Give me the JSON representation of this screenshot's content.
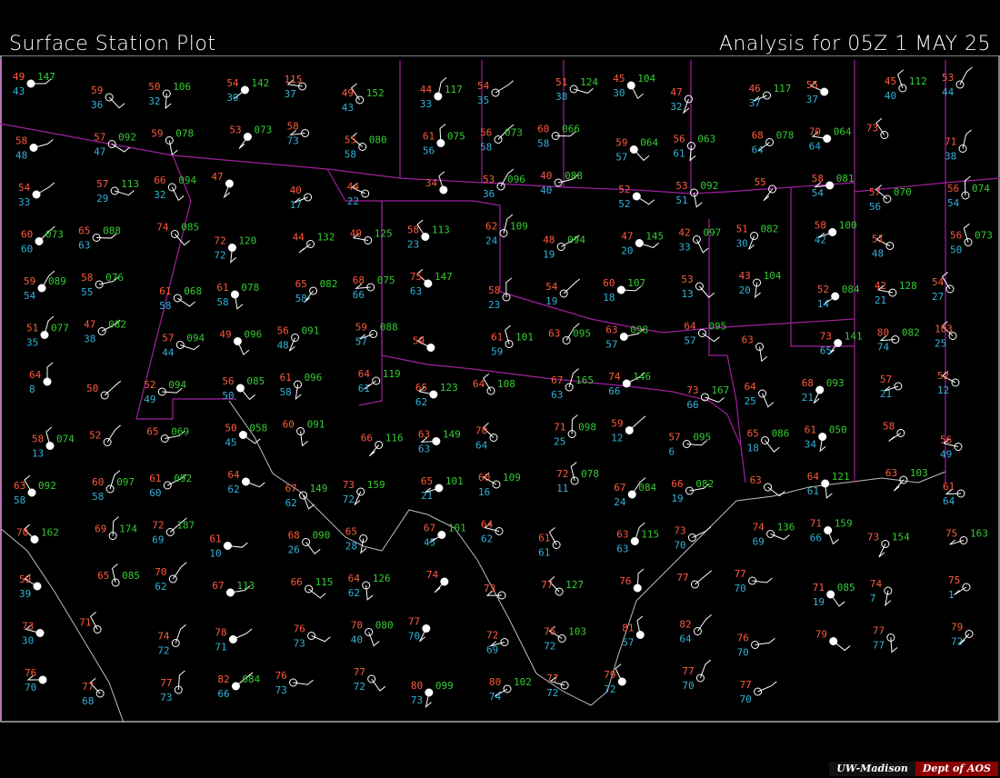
{
  "header": {
    "title": "Surface Station Plot",
    "analysis": "Analysis for 05Z  1 MAY 25"
  },
  "credit": {
    "university": "UW-Madison",
    "dept": "Dept of AOS"
  },
  "colors": {
    "temperature": "#ff5a3c",
    "dewpoint": "#31b2d9",
    "pressure": "#33cc33",
    "station": "#ffffff",
    "borders": "#a020a0",
    "coast": "#cfcfcf"
  },
  "stations": [
    {
      "t": "49",
      "d": "43",
      "p": "147"
    },
    {
      "t": "59",
      "d": "36",
      "p": ""
    },
    {
      "t": "50",
      "d": "32",
      "p": "106"
    },
    {
      "t": "54",
      "d": "39",
      "p": "142"
    },
    {
      "t": "115",
      "d": "37",
      "p": ""
    },
    {
      "t": "49",
      "d": "43",
      "p": "152"
    },
    {
      "t": "44",
      "d": "33",
      "p": "117"
    },
    {
      "t": "54",
      "d": "35",
      "p": ""
    },
    {
      "t": "51",
      "d": "38",
      "p": "124"
    },
    {
      "t": "45",
      "d": "30",
      "p": "104"
    },
    {
      "t": "47",
      "d": "32",
      "p": ""
    },
    {
      "t": "46",
      "d": "37",
      "p": "117"
    },
    {
      "t": "55",
      "d": "37",
      "p": ""
    },
    {
      "t": "45",
      "d": "40",
      "p": "112"
    },
    {
      "t": "53",
      "d": "44",
      "p": ""
    },
    {
      "t": "58",
      "d": "48",
      "p": ""
    },
    {
      "t": "57",
      "d": "47",
      "p": "092"
    },
    {
      "t": "59",
      "d": "",
      "p": "078"
    },
    {
      "t": "53",
      "d": "",
      "p": "073"
    },
    {
      "t": "58",
      "d": "73",
      "p": ""
    },
    {
      "t": "55",
      "d": "58",
      "p": "080"
    },
    {
      "t": "61",
      "d": "56",
      "p": "075"
    },
    {
      "t": "56",
      "d": "58",
      "p": "073"
    },
    {
      "t": "60",
      "d": "58",
      "p": "066"
    },
    {
      "t": "59",
      "d": "57",
      "p": "064"
    },
    {
      "t": "56",
      "d": "61",
      "p": "063"
    },
    {
      "t": "68",
      "d": "64",
      "p": "078"
    },
    {
      "t": "70",
      "d": "64",
      "p": "064"
    },
    {
      "t": "73",
      "d": "",
      "p": ""
    },
    {
      "t": "71",
      "d": "38",
      "p": ""
    },
    {
      "t": "54",
      "d": "33",
      "p": ""
    },
    {
      "t": "57",
      "d": "29",
      "p": "113"
    },
    {
      "t": "66",
      "d": "32",
      "p": "094"
    },
    {
      "t": "47",
      "d": "",
      "p": ""
    },
    {
      "t": "40",
      "d": "17",
      "p": ""
    },
    {
      "t": "44",
      "d": "22",
      "p": ""
    },
    {
      "t": "34",
      "d": "",
      "p": ""
    },
    {
      "t": "53",
      "d": "36",
      "p": "096"
    },
    {
      "t": "40",
      "d": "40",
      "p": "088"
    },
    {
      "t": "52",
      "d": "52",
      "p": ""
    },
    {
      "t": "53",
      "d": "51",
      "p": "092"
    },
    {
      "t": "55",
      "d": "",
      "p": ""
    },
    {
      "t": "58",
      "d": "54",
      "p": "081"
    },
    {
      "t": "57",
      "d": "56",
      "p": "070"
    },
    {
      "t": "56",
      "d": "54",
      "p": "074"
    },
    {
      "t": "60",
      "d": "60",
      "p": "073"
    },
    {
      "t": "65",
      "d": "63",
      "p": "088"
    },
    {
      "t": "74",
      "d": "",
      "p": "085"
    },
    {
      "t": "72",
      "d": "72",
      "p": "120"
    },
    {
      "t": "44",
      "d": "",
      "p": "132"
    },
    {
      "t": "49",
      "d": "",
      "p": "125"
    },
    {
      "t": "58",
      "d": "23",
      "p": "113"
    },
    {
      "t": "62",
      "d": "24",
      "p": "109"
    },
    {
      "t": "48",
      "d": "19",
      "p": "094"
    },
    {
      "t": "47",
      "d": "20",
      "p": "145"
    },
    {
      "t": "42",
      "d": "33",
      "p": "097"
    },
    {
      "t": "51",
      "d": "30",
      "p": "082"
    },
    {
      "t": "58",
      "d": "42",
      "p": "100"
    },
    {
      "t": "51",
      "d": "48",
      "p": ""
    },
    {
      "t": "56",
      "d": "50",
      "p": "073"
    },
    {
      "t": "59",
      "d": "54",
      "p": "089"
    },
    {
      "t": "58",
      "d": "55",
      "p": "076"
    },
    {
      "t": "61",
      "d": "58",
      "p": "068"
    },
    {
      "t": "61",
      "d": "58",
      "p": "078"
    },
    {
      "t": "65",
      "d": "58",
      "p": "082"
    },
    {
      "t": "68",
      "d": "66",
      "p": "075"
    },
    {
      "t": "75",
      "d": "63",
      "p": "147"
    },
    {
      "t": "58",
      "d": "23",
      "p": ""
    },
    {
      "t": "54",
      "d": "19",
      "p": ""
    },
    {
      "t": "60",
      "d": "18",
      "p": "107"
    },
    {
      "t": "53",
      "d": "13",
      "p": ""
    },
    {
      "t": "43",
      "d": "20",
      "p": "104"
    },
    {
      "t": "52",
      "d": "14",
      "p": "084"
    },
    {
      "t": "42",
      "d": "21",
      "p": "128"
    },
    {
      "t": "54",
      "d": "27",
      "p": ""
    },
    {
      "t": "51",
      "d": "35",
      "p": "077"
    },
    {
      "t": "47",
      "d": "38",
      "p": "082"
    },
    {
      "t": "57",
      "d": "44",
      "p": "094"
    },
    {
      "t": "49",
      "d": "",
      "p": "096"
    },
    {
      "t": "56",
      "d": "48",
      "p": "091"
    },
    {
      "t": "59",
      "d": "57",
      "p": "088"
    },
    {
      "t": "59",
      "d": "",
      "p": ""
    },
    {
      "t": "61",
      "d": "59",
      "p": "101"
    },
    {
      "t": "63",
      "d": "",
      "p": "095"
    },
    {
      "t": "63",
      "d": "57",
      "p": "098"
    },
    {
      "t": "64",
      "d": "57",
      "p": "095"
    },
    {
      "t": "63",
      "d": "",
      "p": ""
    },
    {
      "t": "73",
      "d": "65",
      "p": "141"
    },
    {
      "t": "80",
      "d": "74",
      "p": "082"
    },
    {
      "t": "103",
      "d": "25",
      "p": ""
    },
    {
      "t": "64",
      "d": "8",
      "p": ""
    },
    {
      "t": "50",
      "d": "",
      "p": ""
    },
    {
      "t": "52",
      "d": "49",
      "p": "094"
    },
    {
      "t": "56",
      "d": "50",
      "p": "085"
    },
    {
      "t": "61",
      "d": "58",
      "p": "096"
    },
    {
      "t": "64",
      "d": "61",
      "p": "119"
    },
    {
      "t": "65",
      "d": "62",
      "p": "123"
    },
    {
      "t": "64",
      "d": "",
      "p": "108"
    },
    {
      "t": "67",
      "d": "63",
      "p": "165"
    },
    {
      "t": "74",
      "d": "66",
      "p": "146"
    },
    {
      "t": "73",
      "d": "66",
      "p": "167"
    },
    {
      "t": "64",
      "d": "25",
      "p": ""
    },
    {
      "t": "68",
      "d": "21",
      "p": "093"
    },
    {
      "t": "57",
      "d": "21",
      "p": ""
    },
    {
      "t": "52",
      "d": "12",
      "p": ""
    },
    {
      "t": "58",
      "d": "13",
      "p": "074"
    },
    {
      "t": "52",
      "d": "",
      "p": ""
    },
    {
      "t": "65",
      "d": "",
      "p": "069"
    },
    {
      "t": "50",
      "d": "45",
      "p": "058"
    },
    {
      "t": "60",
      "d": "",
      "p": "091"
    },
    {
      "t": "66",
      "d": "",
      "p": "116"
    },
    {
      "t": "63",
      "d": "63",
      "p": "149"
    },
    {
      "t": "70",
      "d": "64",
      "p": ""
    },
    {
      "t": "71",
      "d": "25",
      "p": "098"
    },
    {
      "t": "59",
      "d": "12",
      "p": ""
    },
    {
      "t": "57",
      "d": "6",
      "p": "095"
    },
    {
      "t": "65",
      "d": "18",
      "p": "086"
    },
    {
      "t": "61",
      "d": "34",
      "p": "050"
    },
    {
      "t": "58",
      "d": "",
      "p": ""
    },
    {
      "t": "56",
      "d": "49",
      "p": ""
    },
    {
      "t": "63",
      "d": "58",
      "p": "092"
    },
    {
      "t": "60",
      "d": "58",
      "p": "097"
    },
    {
      "t": "61",
      "d": "60",
      "p": "092"
    },
    {
      "t": "64",
      "d": "62",
      "p": ""
    },
    {
      "t": "67",
      "d": "62",
      "p": "149"
    },
    {
      "t": "73",
      "d": "72",
      "p": "159"
    },
    {
      "t": "65",
      "d": "21",
      "p": "101"
    },
    {
      "t": "60",
      "d": "16",
      "p": "109"
    },
    {
      "t": "72",
      "d": "11",
      "p": "078"
    },
    {
      "t": "67",
      "d": "24",
      "p": "084"
    },
    {
      "t": "66",
      "d": "19",
      "p": "082"
    },
    {
      "t": "63",
      "d": "",
      "p": ""
    },
    {
      "t": "64",
      "d": "61",
      "p": "121"
    },
    {
      "t": "63",
      "d": "",
      "p": "103"
    },
    {
      "t": "61",
      "d": "64",
      "p": ""
    },
    {
      "t": "70",
      "d": "",
      "p": "162"
    },
    {
      "t": "69",
      "d": "",
      "p": "174"
    },
    {
      "t": "72",
      "d": "69",
      "p": "187"
    },
    {
      "t": "61",
      "d": "10",
      "p": ""
    },
    {
      "t": "68",
      "d": "26",
      "p": "090"
    },
    {
      "t": "65",
      "d": "28",
      "p": ""
    },
    {
      "t": "67",
      "d": "45",
      "p": "101"
    },
    {
      "t": "64",
      "d": "62",
      "p": ""
    },
    {
      "t": "61",
      "d": "61",
      "p": ""
    },
    {
      "t": "63",
      "d": "63",
      "p": "115"
    },
    {
      "t": "73",
      "d": "70",
      "p": ""
    },
    {
      "t": "74",
      "d": "69",
      "p": "136"
    },
    {
      "t": "71",
      "d": "66",
      "p": "159"
    },
    {
      "t": "73",
      "d": "",
      "p": "154"
    },
    {
      "t": "75",
      "d": "",
      "p": "163"
    },
    {
      "t": "59",
      "d": "39",
      "p": ""
    },
    {
      "t": "65",
      "d": "",
      "p": "085"
    },
    {
      "t": "70",
      "d": "62",
      "p": ""
    },
    {
      "t": "67",
      "d": "",
      "p": "113"
    },
    {
      "t": "66",
      "d": "",
      "p": "115"
    },
    {
      "t": "64",
      "d": "62",
      "p": "126"
    },
    {
      "t": "74",
      "d": "",
      "p": ""
    },
    {
      "t": "73",
      "d": "",
      "p": ""
    },
    {
      "t": "77",
      "d": "",
      "p": "127"
    },
    {
      "t": "76",
      "d": "",
      "p": ""
    },
    {
      "t": "77",
      "d": "",
      "p": ""
    },
    {
      "t": "77",
      "d": "70",
      "p": ""
    },
    {
      "t": "71",
      "d": "19",
      "p": "085"
    },
    {
      "t": "74",
      "d": "7",
      "p": ""
    },
    {
      "t": "75",
      "d": "1",
      "p": ""
    },
    {
      "t": "73",
      "d": "30",
      "p": ""
    },
    {
      "t": "71",
      "d": "",
      "p": ""
    },
    {
      "t": "74",
      "d": "72",
      "p": ""
    },
    {
      "t": "78",
      "d": "71",
      "p": ""
    },
    {
      "t": "76",
      "d": "73",
      "p": ""
    },
    {
      "t": "70",
      "d": "40",
      "p": "080"
    },
    {
      "t": "77",
      "d": "70",
      "p": ""
    },
    {
      "t": "72",
      "d": "69",
      "p": ""
    },
    {
      "t": "76",
      "d": "72",
      "p": "103"
    },
    {
      "t": "81",
      "d": "57",
      "p": ""
    },
    {
      "t": "82",
      "d": "64",
      "p": ""
    },
    {
      "t": "76",
      "d": "70",
      "p": ""
    },
    {
      "t": "79",
      "d": "",
      "p": ""
    },
    {
      "t": "77",
      "d": "77",
      "p": ""
    },
    {
      "t": "79",
      "d": "72",
      "p": ""
    },
    {
      "t": "76",
      "d": "70",
      "p": ""
    },
    {
      "t": "77",
      "d": "68",
      "p": ""
    },
    {
      "t": "77",
      "d": "73",
      "p": ""
    },
    {
      "t": "82",
      "d": "66",
      "p": "084"
    },
    {
      "t": "76",
      "d": "73",
      "p": ""
    },
    {
      "t": "77",
      "d": "72",
      "p": ""
    },
    {
      "t": "80",
      "d": "73",
      "p": "099"
    },
    {
      "t": "80",
      "d": "74",
      "p": "102"
    },
    {
      "t": "77",
      "d": "72",
      "p": ""
    },
    {
      "t": "79",
      "d": "72",
      "p": ""
    },
    {
      "t": "77",
      "d": "70",
      "p": ""
    },
    {
      "t": "77",
      "d": "70",
      "p": ""
    }
  ]
}
